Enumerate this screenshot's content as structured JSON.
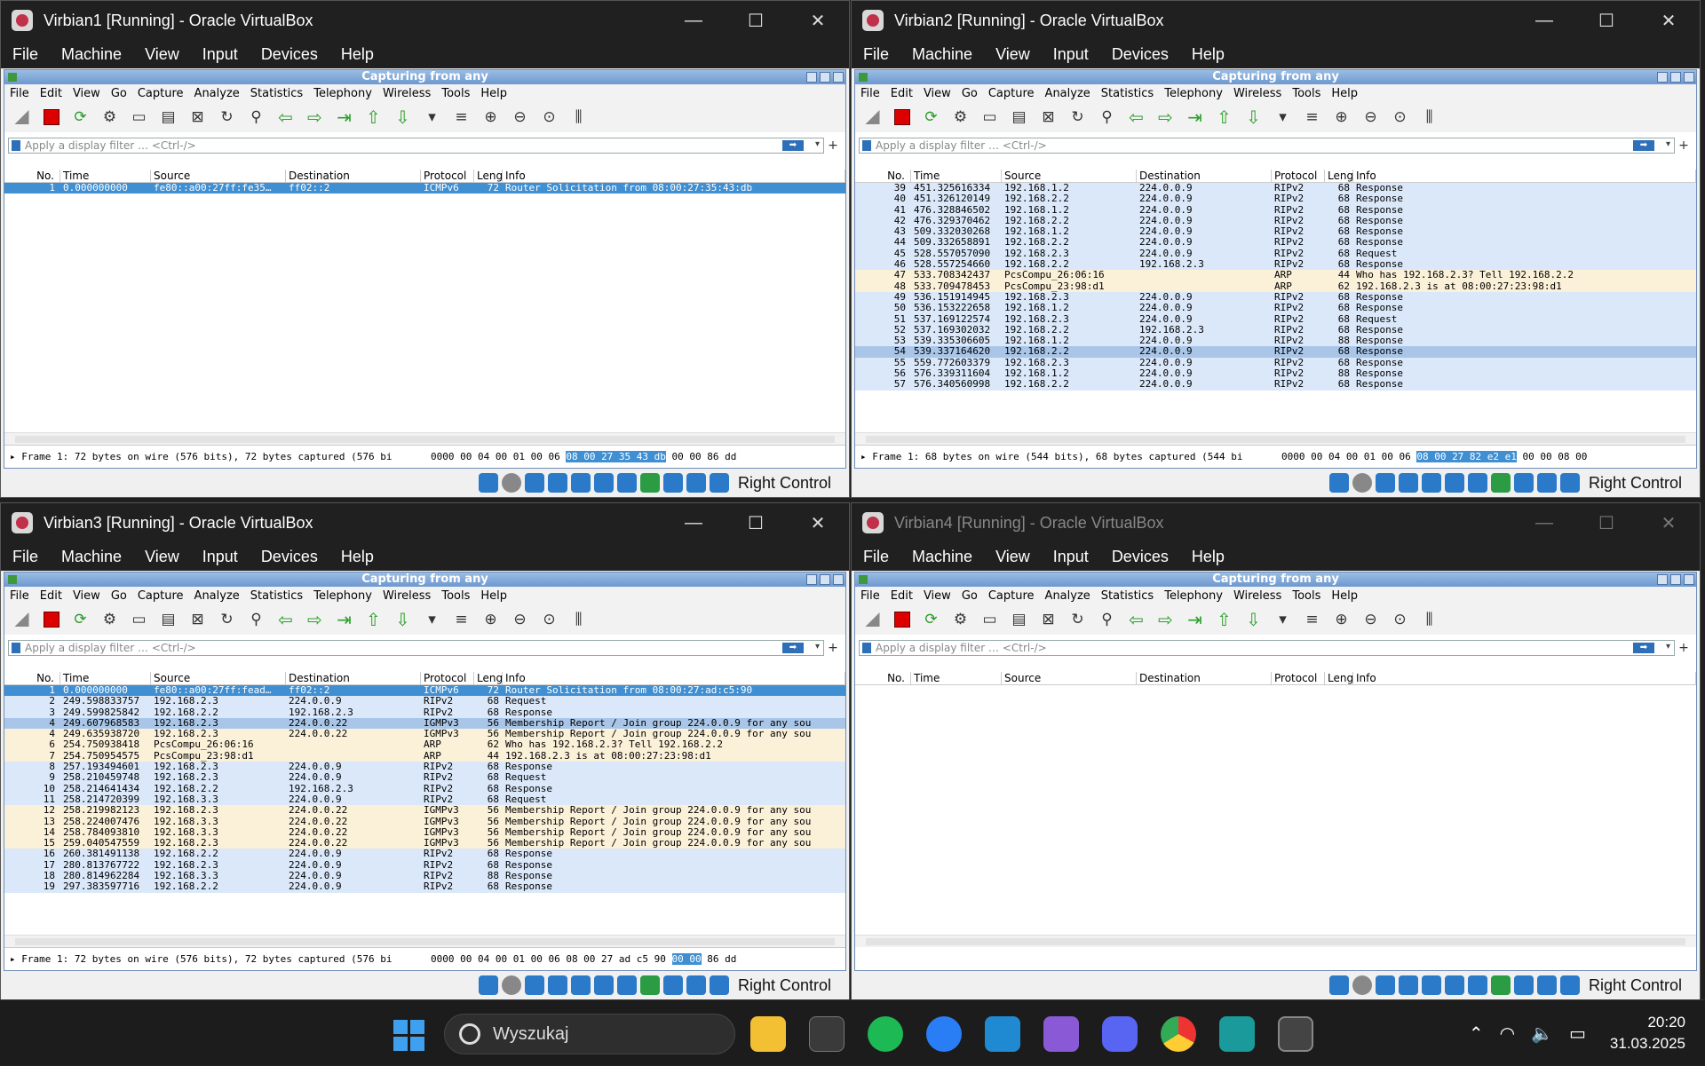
{
  "vm1": {
    "title": "Virbian1 [Running] - Oracle VirtualBox",
    "detail_frame": "▸ Frame 1: 72 bytes on wire (576 bits), 72 bytes captured (576 bi",
    "hex_pre": "0000  00 04 00 01 00 06 ",
    "hex_hl": "08 00  27 35 43 db",
    "hex_post": " 00 00 86 dd",
    "rows": [
      {
        "no": "1",
        "time": "0.000000000",
        "src": "fe80::a00:27ff:fe35…",
        "dst": "ff02::2",
        "proto": "ICMPv6",
        "len": "72",
        "info": "Router Solicitation from 08:00:27:35:43:db",
        "cls": "sel"
      }
    ]
  },
  "vm2": {
    "title": "Virbian2 [Running] - Oracle VirtualBox",
    "detail_frame": "▸ Frame 1: 68 bytes on wire (544 bits), 68 bytes captured (544 bi",
    "hex_pre": "0000  00 04 00 01 00 06 ",
    "hex_hl": "08 00  27 82 e2 e1",
    "hex_post": " 00 00 08 00",
    "rows": [
      {
        "no": "39",
        "time": "451.325616334",
        "src": "192.168.1.2",
        "dst": "224.0.0.9",
        "proto": "RIPv2",
        "len": "68",
        "info": "Response",
        "cls": "rip"
      },
      {
        "no": "40",
        "time": "451.326120149",
        "src": "192.168.2.2",
        "dst": "224.0.0.9",
        "proto": "RIPv2",
        "len": "68",
        "info": "Response",
        "cls": "rip"
      },
      {
        "no": "41",
        "time": "476.328846502",
        "src": "192.168.1.2",
        "dst": "224.0.0.9",
        "proto": "RIPv2",
        "len": "68",
        "info": "Response",
        "cls": "rip"
      },
      {
        "no": "42",
        "time": "476.329370462",
        "src": "192.168.2.2",
        "dst": "224.0.0.9",
        "proto": "RIPv2",
        "len": "68",
        "info": "Response",
        "cls": "rip"
      },
      {
        "no": "43",
        "time": "509.332030268",
        "src": "192.168.1.2",
        "dst": "224.0.0.9",
        "proto": "RIPv2",
        "len": "68",
        "info": "Response",
        "cls": "rip"
      },
      {
        "no": "44",
        "time": "509.332658891",
        "src": "192.168.2.2",
        "dst": "224.0.0.9",
        "proto": "RIPv2",
        "len": "68",
        "info": "Response",
        "cls": "rip"
      },
      {
        "no": "45",
        "time": "528.557057090",
        "src": "192.168.2.3",
        "dst": "224.0.0.9",
        "proto": "RIPv2",
        "len": "68",
        "info": "Request",
        "cls": "rip"
      },
      {
        "no": "46",
        "time": "528.557254660",
        "src": "192.168.2.2",
        "dst": "192.168.2.3",
        "proto": "RIPv2",
        "len": "68",
        "info": "Response",
        "cls": "rip"
      },
      {
        "no": "47",
        "time": "533.708342437",
        "src": "PcsCompu_26:06:16",
        "dst": "",
        "proto": "ARP",
        "len": "44",
        "info": "Who has 192.168.2.3? Tell 192.168.2.2",
        "cls": "arp"
      },
      {
        "no": "48",
        "time": "533.709478453",
        "src": "PcsCompu_23:98:d1",
        "dst": "",
        "proto": "ARP",
        "len": "62",
        "info": "192.168.2.3 is at 08:00:27:23:98:d1",
        "cls": "arp"
      },
      {
        "no": "49",
        "time": "536.151914945",
        "src": "192.168.2.3",
        "dst": "224.0.0.9",
        "proto": "RIPv2",
        "len": "68",
        "info": "Response",
        "cls": "rip"
      },
      {
        "no": "50",
        "time": "536.153222658",
        "src": "192.168.1.2",
        "dst": "224.0.0.9",
        "proto": "RIPv2",
        "len": "68",
        "info": "Response",
        "cls": "rip"
      },
      {
        "no": "51",
        "time": "537.169122574",
        "src": "192.168.2.3",
        "dst": "224.0.0.9",
        "proto": "RIPv2",
        "len": "68",
        "info": "Request",
        "cls": "rip"
      },
      {
        "no": "52",
        "time": "537.169302032",
        "src": "192.168.2.2",
        "dst": "192.168.2.3",
        "proto": "RIPv2",
        "len": "68",
        "info": "Response",
        "cls": "rip"
      },
      {
        "no": "53",
        "time": "539.335306605",
        "src": "192.168.1.2",
        "dst": "224.0.0.9",
        "proto": "RIPv2",
        "len": "88",
        "info": "Response",
        "cls": "rip"
      },
      {
        "no": "54",
        "time": "539.337164620",
        "src": "192.168.2.2",
        "dst": "224.0.0.9",
        "proto": "RIPv2",
        "len": "68",
        "info": "Response",
        "cls": "hl"
      },
      {
        "no": "55",
        "time": "559.772603379",
        "src": "192.168.2.3",
        "dst": "224.0.0.9",
        "proto": "RIPv2",
        "len": "68",
        "info": "Response",
        "cls": "rip"
      },
      {
        "no": "56",
        "time": "576.339311604",
        "src": "192.168.1.2",
        "dst": "224.0.0.9",
        "proto": "RIPv2",
        "len": "88",
        "info": "Response",
        "cls": "rip"
      },
      {
        "no": "57",
        "time": "576.340560998",
        "src": "192.168.2.2",
        "dst": "224.0.0.9",
        "proto": "RIPv2",
        "len": "68",
        "info": "Response",
        "cls": "rip"
      }
    ]
  },
  "vm3": {
    "title": "Virbian3 [Running] - Oracle VirtualBox",
    "detail_frame": "▸ Frame 1: 72 bytes on wire (576 bits), 72 bytes captured (576 bi",
    "hex_pre": "0000  00 04 00 01 00 06 08 00  27 ad c5 90 ",
    "hex_hl": "00 00",
    "hex_post": " 86 dd",
    "rows": [
      {
        "no": "1",
        "time": "0.000000000",
        "src": "fe80::a00:27ff:fead…",
        "dst": "ff02::2",
        "proto": "ICMPv6",
        "len": "72",
        "info": "Router Solicitation from 08:00:27:ad:c5:90",
        "cls": "sel"
      },
      {
        "no": "2",
        "time": "249.598833757",
        "src": "192.168.2.3",
        "dst": "224.0.0.9",
        "proto": "RIPv2",
        "len": "68",
        "info": "Request",
        "cls": "rip"
      },
      {
        "no": "3",
        "time": "249.599825842",
        "src": "192.168.2.2",
        "dst": "192.168.2.3",
        "proto": "RIPv2",
        "len": "68",
        "info": "Response",
        "cls": "rip"
      },
      {
        "no": "4",
        "time": "249.607968583",
        "src": "192.168.2.3",
        "dst": "224.0.0.22",
        "proto": "IGMPv3",
        "len": "56",
        "info": "Membership Report / Join group 224.0.0.9 for any sou",
        "cls": "hl"
      },
      {
        "no": "4",
        "time": "249.635938720",
        "src": "192.168.2.3",
        "dst": "224.0.0.22",
        "proto": "IGMPv3",
        "len": "56",
        "info": "Membership Report / Join group 224.0.0.9 for any sou",
        "cls": "igmp"
      },
      {
        "no": "6",
        "time": "254.750938418",
        "src": "PcsCompu_26:06:16",
        "dst": "",
        "proto": "ARP",
        "len": "62",
        "info": "Who has 192.168.2.3? Tell 192.168.2.2",
        "cls": "arp"
      },
      {
        "no": "7",
        "time": "254.750954575",
        "src": "PcsCompu_23:98:d1",
        "dst": "",
        "proto": "ARP",
        "len": "44",
        "info": "192.168.2.3 is at 08:00:27:23:98:d1",
        "cls": "arp"
      },
      {
        "no": "8",
        "time": "257.193494601",
        "src": "192.168.2.3",
        "dst": "224.0.0.9",
        "proto": "RIPv2",
        "len": "68",
        "info": "Response",
        "cls": "rip"
      },
      {
        "no": "9",
        "time": "258.210459748",
        "src": "192.168.2.3",
        "dst": "224.0.0.9",
        "proto": "RIPv2",
        "len": "68",
        "info": "Request",
        "cls": "rip"
      },
      {
        "no": "10",
        "time": "258.214641434",
        "src": "192.168.2.2",
        "dst": "192.168.2.3",
        "proto": "RIPv2",
        "len": "68",
        "info": "Response",
        "cls": "rip"
      },
      {
        "no": "11",
        "time": "258.214720399",
        "src": "192.168.3.3",
        "dst": "224.0.0.9",
        "proto": "RIPv2",
        "len": "68",
        "info": "Request",
        "cls": "rip"
      },
      {
        "no": "12",
        "time": "258.219982123",
        "src": "192.168.2.3",
        "dst": "224.0.0.22",
        "proto": "IGMPv3",
        "len": "56",
        "info": "Membership Report / Join group 224.0.0.9 for any sou",
        "cls": "igmp"
      },
      {
        "no": "13",
        "time": "258.224007476",
        "src": "192.168.3.3",
        "dst": "224.0.0.22",
        "proto": "IGMPv3",
        "len": "56",
        "info": "Membership Report / Join group 224.0.0.9 for any sou",
        "cls": "igmp"
      },
      {
        "no": "14",
        "time": "258.784093810",
        "src": "192.168.3.3",
        "dst": "224.0.0.22",
        "proto": "IGMPv3",
        "len": "56",
        "info": "Membership Report / Join group 224.0.0.9 for any sou",
        "cls": "igmp"
      },
      {
        "no": "15",
        "time": "259.040547559",
        "src": "192.168.2.3",
        "dst": "224.0.0.22",
        "proto": "IGMPv3",
        "len": "56",
        "info": "Membership Report / Join group 224.0.0.9 for any sou",
        "cls": "igmp"
      },
      {
        "no": "16",
        "time": "260.381491138",
        "src": "192.168.2.2",
        "dst": "224.0.0.9",
        "proto": "RIPv2",
        "len": "68",
        "info": "Response",
        "cls": "rip"
      },
      {
        "no": "17",
        "time": "280.813767722",
        "src": "192.168.2.3",
        "dst": "224.0.0.9",
        "proto": "RIPv2",
        "len": "68",
        "info": "Response",
        "cls": "rip"
      },
      {
        "no": "18",
        "time": "280.814962284",
        "src": "192.168.3.3",
        "dst": "224.0.0.9",
        "proto": "RIPv2",
        "len": "88",
        "info": "Response",
        "cls": "rip"
      },
      {
        "no": "19",
        "time": "297.383597716",
        "src": "192.168.2.2",
        "dst": "224.0.0.9",
        "proto": "RIPv2",
        "len": "68",
        "info": "Response",
        "cls": "rip"
      }
    ]
  },
  "vm4": {
    "title": "Virbian4 [Running] - Oracle VirtualBox",
    "rows": []
  },
  "common": {
    "vb_menu": [
      "File",
      "Machine",
      "View",
      "Input",
      "Devices",
      "Help"
    ],
    "ws_title": "Capturing from any",
    "ws_menu": [
      "File",
      "Edit",
      "View",
      "Go",
      "Capture",
      "Analyze",
      "Statistics",
      "Telephony",
      "Wireless",
      "Tools",
      "Help"
    ],
    "filter_placeholder": "Apply a display filter … <Ctrl-/>",
    "columns": [
      "No.",
      "Time",
      "Source",
      "Destination",
      "Protocol",
      "Length",
      "Info"
    ],
    "host_key": "Right Control",
    "minimize": "—",
    "maximize": "☐",
    "close": "✕"
  },
  "taskbar": {
    "search_label": "Wyszukaj",
    "time": "20:20",
    "date": "31.03.2025"
  }
}
